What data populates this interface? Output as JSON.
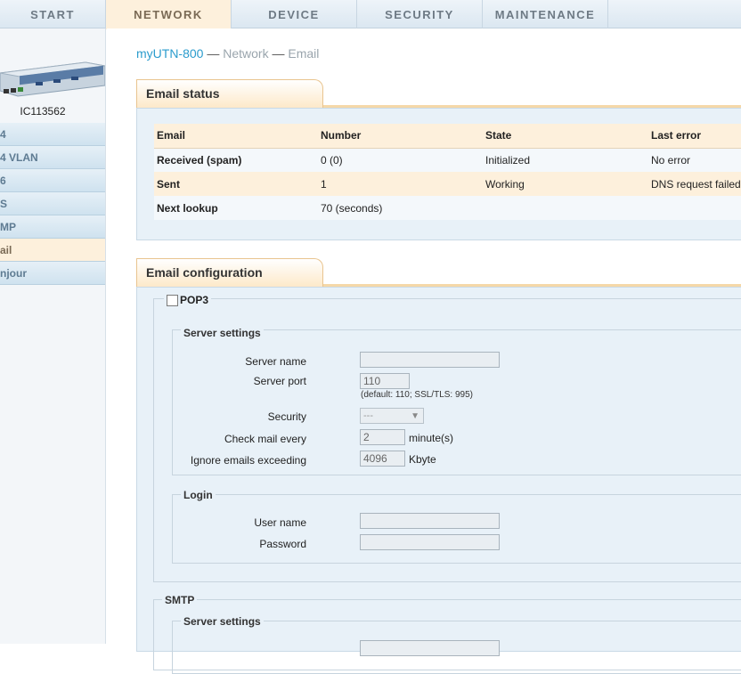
{
  "nav": {
    "tabs": [
      "START",
      "NETWORK",
      "DEVICE",
      "SECURITY",
      "MAINTENANCE"
    ],
    "active": "NETWORK"
  },
  "sidebar": {
    "device_id": "IC113562",
    "items": [
      "4",
      "4 VLAN",
      "6",
      "S",
      "MP",
      "ail",
      "njour"
    ],
    "active_index": 5
  },
  "breadcrumb": {
    "home": "myUTN-800",
    "sep1": "—",
    "level1": "Network",
    "sep2": "—",
    "level2": "Email"
  },
  "email_status": {
    "title": "Email status",
    "headers": [
      "Email",
      "Number",
      "State",
      "Last error"
    ],
    "rows": [
      [
        "Received (spam)",
        "0  (0)",
        "Initialized",
        "No error"
      ],
      [
        "Sent",
        "1",
        "Working",
        "DNS request failed"
      ],
      [
        "Next lookup",
        "70 (seconds)",
        "",
        ""
      ]
    ]
  },
  "email_config": {
    "title": "Email configuration",
    "pop3": {
      "label": "POP3",
      "checked": false,
      "server_settings": {
        "legend": "Server settings",
        "server_name_label": "Server name",
        "server_name_value": "",
        "server_port_label": "Server port",
        "server_port_value": "110",
        "server_port_hint": "(default: 110; SSL/TLS: 995)",
        "security_label": "Security",
        "security_value": "---",
        "check_every_label": "Check mail every",
        "check_every_value": "2",
        "check_every_unit": "minute(s)",
        "ignore_label": "Ignore emails exceeding",
        "ignore_value": "4096",
        "ignore_unit": "Kbyte"
      },
      "login": {
        "legend": "Login",
        "username_label": "User name",
        "username_value": "",
        "password_label": "Password",
        "password_value": ""
      }
    },
    "smtp": {
      "label": "SMTP",
      "server_settings_legend": "Server settings"
    }
  },
  "colors": {
    "accent": "#2b9ccd",
    "active_tab": "#fdf0dc",
    "panel": "#e8f1f8"
  }
}
